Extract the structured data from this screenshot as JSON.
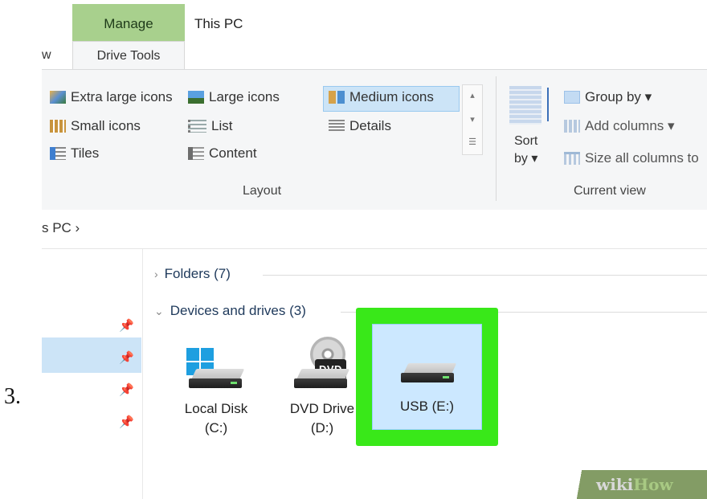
{
  "step_label": "3.",
  "ribbon": {
    "context_tab": "Manage",
    "window_title": "This PC",
    "tabs": {
      "partial_view": "w",
      "drive_tools": "Drive Tools"
    },
    "layout": {
      "extra_large_icons": "Extra large icons",
      "large_icons": "Large icons",
      "medium_icons": "Medium icons",
      "small_icons": "Small icons",
      "list": "List",
      "details": "Details",
      "tiles": "Tiles",
      "content": "Content",
      "group_label": "Layout",
      "selected": "Medium icons"
    },
    "current_view": {
      "sort_by_line1": "Sort",
      "sort_by_line2": "by ▾",
      "group_by": "Group by ▾",
      "add_columns": "Add columns ▾",
      "size_all_columns": "Size all columns to",
      "group_label": "Current view"
    }
  },
  "address": {
    "path": "s PC  ›"
  },
  "content": {
    "folders_header": "Folders (7)",
    "devices_header": "Devices and drives (3)",
    "drives": [
      {
        "line1": "Local Disk",
        "line2": "(C:)"
      },
      {
        "line1": "DVD Drive",
        "line2": "(D:)",
        "badge": "DVD"
      },
      {
        "line1": "USB (E:)",
        "line2": ""
      }
    ]
  },
  "watermark": {
    "part1": "wiki",
    "part2": "How"
  },
  "colors": {
    "highlight": "#39e819",
    "manage_tab": "#a8d08d",
    "selection": "#cce4f7"
  }
}
